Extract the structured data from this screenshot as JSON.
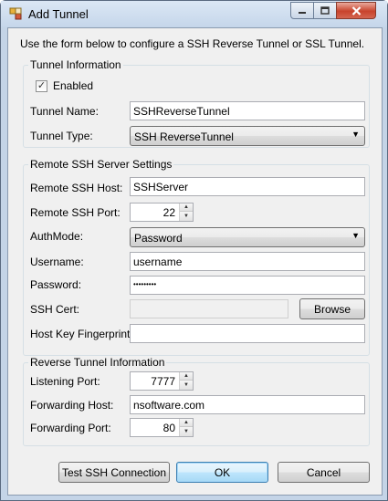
{
  "window": {
    "title": "Add Tunnel"
  },
  "intro": "Use the form below to configure a SSH Reverse Tunnel or SSL Tunnel.",
  "tunnel_info": {
    "title": "Tunnel Information",
    "enabled_label": "Enabled",
    "enabled_checked": true,
    "enabled_mark": "✓",
    "name_label": "Tunnel Name:",
    "name_value": "SSHReverseTunnel",
    "type_label": "Tunnel Type:",
    "type_value": "SSH ReverseTunnel"
  },
  "ssh_server": {
    "title": "Remote SSH Server Settings",
    "host_label": "Remote SSH Host:",
    "host_value": "SSHServer",
    "port_label": "Remote SSH Port:",
    "port_value": "22",
    "authmode_label": "AuthMode:",
    "authmode_value": "Password",
    "username_label": "Username:",
    "username_value": "username",
    "password_label": "Password:",
    "password_value": "•••••••••",
    "cert_label": "SSH Cert:",
    "cert_value": "",
    "browse_label": "Browse",
    "fingerprint_label": "Host Key Fingerprint:",
    "fingerprint_value": ""
  },
  "reverse_tunnel": {
    "title": "Reverse Tunnel Information",
    "listen_port_label": "Listening Port:",
    "listen_port_value": "7777",
    "fwd_host_label": "Forwarding Host:",
    "fwd_host_value": "nsoftware.com",
    "fwd_port_label": "Forwarding Port:",
    "fwd_port_value": "80"
  },
  "buttons": {
    "test": "Test SSH Connection",
    "ok": "OK",
    "cancel": "Cancel"
  },
  "glyphs": {
    "combo_arrow": "▼",
    "spin_up": "▲",
    "spin_down": "▼"
  }
}
